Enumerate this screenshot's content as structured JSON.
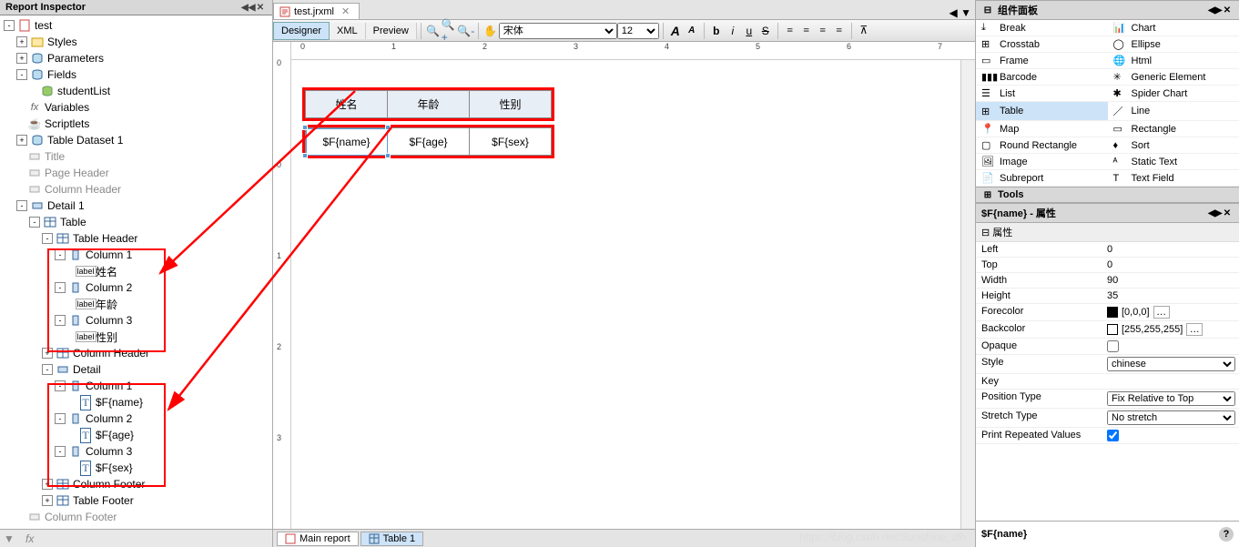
{
  "left_panel": {
    "title": "Report Inspector",
    "tree": {
      "root": "test",
      "styles": "Styles",
      "parameters": "Parameters",
      "fields": "Fields",
      "studentList": "studentList",
      "variables": "Variables",
      "scriptlets": "Scriptlets",
      "table_dataset": "Table Dataset 1",
      "title_band": "Title",
      "page_header": "Page Header",
      "column_header": "Column Header",
      "detail1": "Detail 1",
      "table": "Table",
      "table_header": "Table Header",
      "col1": "Column 1",
      "label_name": "姓名",
      "col2": "Column 2",
      "label_age": "年龄",
      "col3": "Column 3",
      "label_sex": "性别",
      "column_header2": "Column Header",
      "detail": "Detail",
      "dcol1": "Column 1",
      "f_name": "$F{name}",
      "dcol2": "Column 2",
      "f_age": "$F{age}",
      "dcol3": "Column 3",
      "f_sex": "$F{sex}",
      "column_footer2": "Column Footer",
      "table_footer": "Table Footer",
      "column_footer": "Column Footer"
    }
  },
  "center": {
    "file_tab": "test.jrxml",
    "views": {
      "designer": "Designer",
      "xml": "XML",
      "preview": "Preview"
    },
    "font": "宋体",
    "font_size": "12",
    "table": {
      "headers": [
        "姓名",
        "年龄",
        "性别"
      ],
      "fields": [
        "$F{name}",
        "$F{age}",
        "$F{sex}"
      ]
    },
    "bottom_tabs": {
      "main": "Main report",
      "table1": "Table 1"
    }
  },
  "right_panel": {
    "palette_title": "组件面板",
    "palette": [
      [
        "Break",
        "Chart"
      ],
      [
        "Crosstab",
        "Ellipse"
      ],
      [
        "Frame",
        "Html"
      ],
      [
        "Barcode",
        "Generic Element"
      ],
      [
        "List",
        "Spider Chart"
      ],
      [
        "Table",
        "Line"
      ],
      [
        "Map",
        "Rectangle"
      ],
      [
        "Round Rectangle",
        "Sort"
      ],
      [
        "Image",
        "Static Text"
      ],
      [
        "Subreport",
        "Text Field"
      ]
    ],
    "tools_title": "Tools",
    "props_title": "$F{name} - 属性",
    "prop_cat": "属性",
    "props": {
      "Left": "0",
      "Top": "0",
      "Width": "90",
      "Height": "35",
      "Forecolor": "[0,0,0]",
      "Backcolor": "[255,255,255]",
      "Opaque": "",
      "Style": "chinese",
      "Key": "",
      "Position Type": "Fix Relative to Top",
      "Stretch Type": "No stretch",
      "Print Repeated Values": "checked"
    },
    "footer": "$F{name}"
  },
  "watermark": "https://blog.csdn.net/Sunshine_zlh"
}
